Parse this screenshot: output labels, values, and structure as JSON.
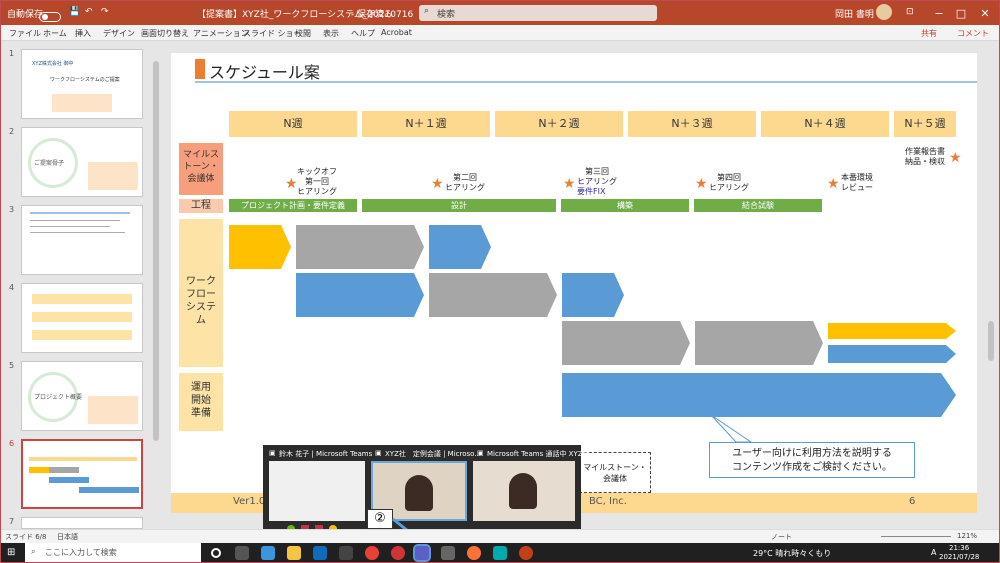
{
  "titlebar": {
    "autosave_label": "自動保存",
    "autosave_state": "オフ",
    "doc_title": "【提案書】XYZ社_ワークフローシステム_20210716",
    "save_state": "- 保存済み",
    "search_placeholder": "検索",
    "user_name": "岡田 書明",
    "min": "−",
    "max": "□",
    "close": "✕"
  },
  "ribbon": {
    "tabs": [
      "ファイル",
      "ホーム",
      "挿入",
      "デザイン",
      "画面切り替え",
      "アニメーション",
      "スライド ショー",
      "校閲",
      "表示",
      "ヘルプ",
      "Acrobat"
    ],
    "share_label": "共有",
    "comment_label": "コメント"
  },
  "thumbs": [
    {
      "num": "1",
      "title": "ワークフローシステムのご提案",
      "sub": "XYZ株式会社 御中"
    },
    {
      "num": "2",
      "title": "ご提案骨子"
    },
    {
      "num": "3",
      "title": ""
    },
    {
      "num": "4",
      "title": ""
    },
    {
      "num": "5",
      "title": "プロジェクト概要"
    },
    {
      "num": "6",
      "title": "スケジュール案"
    },
    {
      "num": "7",
      "title": ""
    }
  ],
  "slide": {
    "title": "スケジュール案",
    "weeks": [
      "N週",
      "N＋１週",
      "N＋２週",
      "N＋３週",
      "N＋４週",
      "N＋５週"
    ],
    "rows": {
      "milestone": "マイルストーン・会議体",
      "process": "工程",
      "workflow": "ワークフローシステム",
      "operation": "運用開始準備"
    },
    "milestones": [
      "キックオフ\n第一回\nヒアリング",
      "第二回\nヒアリング",
      "第三回\nヒアリング",
      "要件FIX",
      "第四回\nヒアリング",
      "本番環境\nレビュー",
      "作業報告書\n納品・検収"
    ],
    "processes": [
      "プロジェクト計画・要件定義",
      "設計",
      "構築",
      "結合試験"
    ],
    "callout": "ユーザー向けに利用方法を説明する\nコンテンツ作成をご検討ください。",
    "dashbox": "マイルストーン・\n会議体",
    "footer_left": "Ver1.0",
    "footer_mid": "BC, Inc.",
    "page_num": "6"
  },
  "teams_popup": {
    "win1": "鈴木 花子 | Microsoft Teams",
    "win2": "XYZ社　定例会議 | Microso...",
    "win3": "Microsoft Teams 通話中 XYZ社..."
  },
  "badge": "②",
  "status": {
    "slide_info": "スライド 6/8",
    "lang": "日本語",
    "notes": "ノート",
    "zoom": "121%"
  },
  "taskbar": {
    "search_placeholder": "ここに入力して検索",
    "weather": "29°C 晴れ時々くもり",
    "ime": "A",
    "time": "21:36",
    "date": "2021/07/28"
  },
  "colors": {
    "accent": "#b7472a",
    "header_orange": "#fdd98f",
    "side_red": "#f79e7d",
    "blue": "#5b9bd5",
    "gray": "#a6a6a6",
    "yellow": "#ffc000",
    "green": "#70ad47"
  }
}
